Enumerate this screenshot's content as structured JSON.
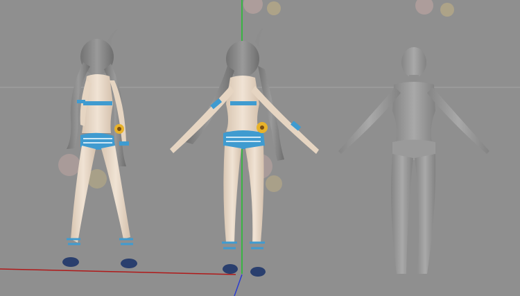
{
  "scene": {
    "background": "#8f8f8f",
    "grid_line_color": "#a4a4a4",
    "axis_colors": {
      "x": "#b01818",
      "y": "#1fc02b",
      "z": "#2a3cd0"
    },
    "icons": {
      "figure_left": "posed-character-back-view-icon",
      "figure_center": "tpose-character-back-view-icon",
      "figure_right": "base-mesh-back-view-icon"
    },
    "palette": {
      "skin": "#eadbcb",
      "hair": "#8d8d8d",
      "swimsuit": "#3f9bd0",
      "swimsuit_light": "#cfe8f5",
      "shoe": "#2a3f6e",
      "sunflower": "#e8b22a",
      "base_mesh": "#9e9e9e"
    }
  }
}
